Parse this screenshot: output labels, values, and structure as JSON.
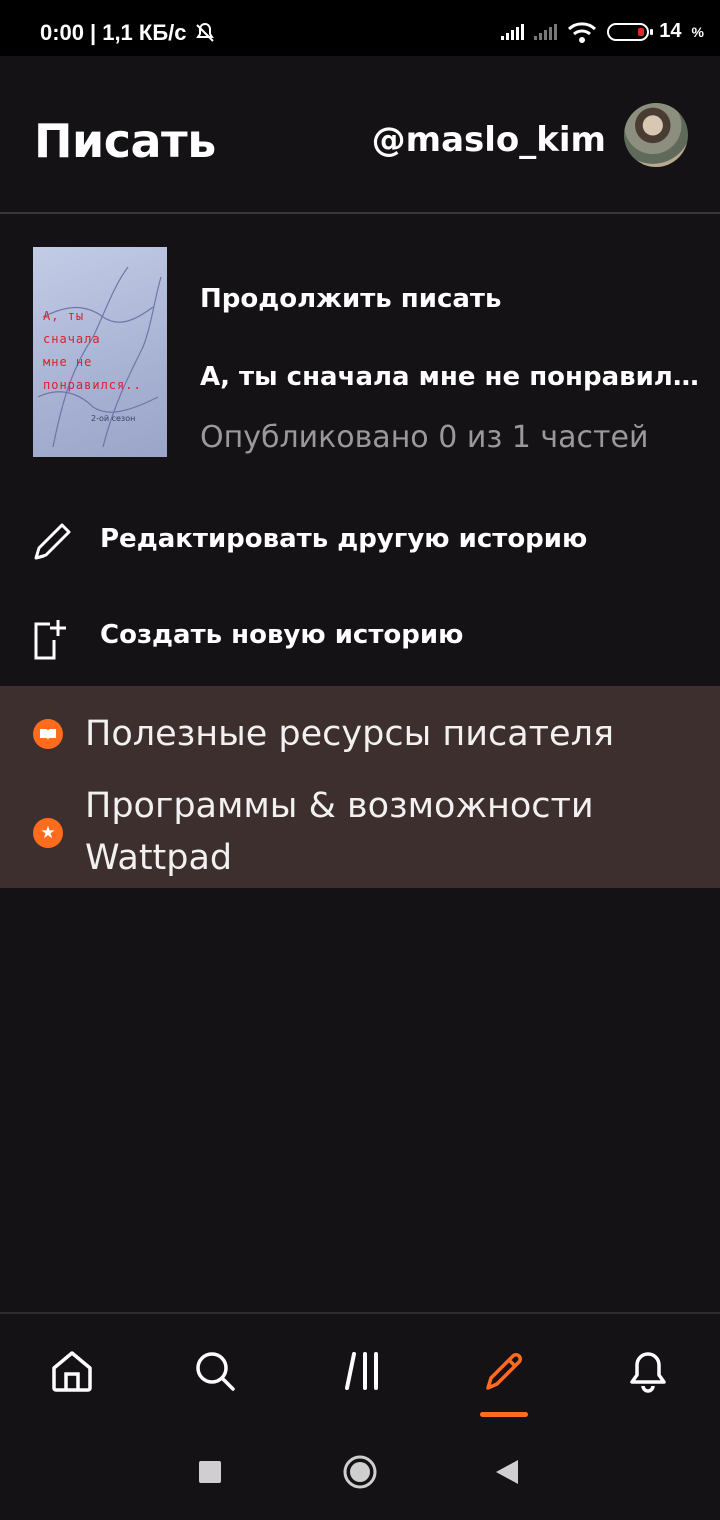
{
  "status_bar": {
    "time": "0:00",
    "separator": "|",
    "speed": "1,1 КБ/с",
    "battery_level": "14",
    "battery_unit": "%",
    "icons": [
      "mute-icon",
      "signal-icon",
      "signal-icon",
      "wifi-icon",
      "battery-icon"
    ]
  },
  "header": {
    "title": "Писать",
    "username": "@maslo_kim"
  },
  "continue": {
    "label": "Продолжить писать",
    "story_title": "А, ты сначала мне не понравил…",
    "meta": "Опубликовано 0 из 1 частей",
    "cover_text_lines": [
      "А, ты",
      "сначала",
      "мне не",
      "понравился.."
    ],
    "cover_subtitle": "2-ой сезон"
  },
  "actions": {
    "edit_label": "Редактировать другую историю",
    "create_label": "Создать новую историю"
  },
  "resources": {
    "items": [
      {
        "label": "Полезные ресурсы писателя",
        "icon": "book-icon"
      },
      {
        "label": "Программы & возможности Wattpad",
        "icon": "star-icon"
      }
    ]
  },
  "bottom_nav": {
    "items": [
      "home-icon",
      "search-icon",
      "library-icon",
      "write-icon",
      "bell-icon"
    ],
    "active": "write-icon"
  },
  "colors": {
    "accent": "#ff6c1e",
    "background": "#141215",
    "resources_bg": "#3c2f2d",
    "muted_text": "#9a989c"
  }
}
